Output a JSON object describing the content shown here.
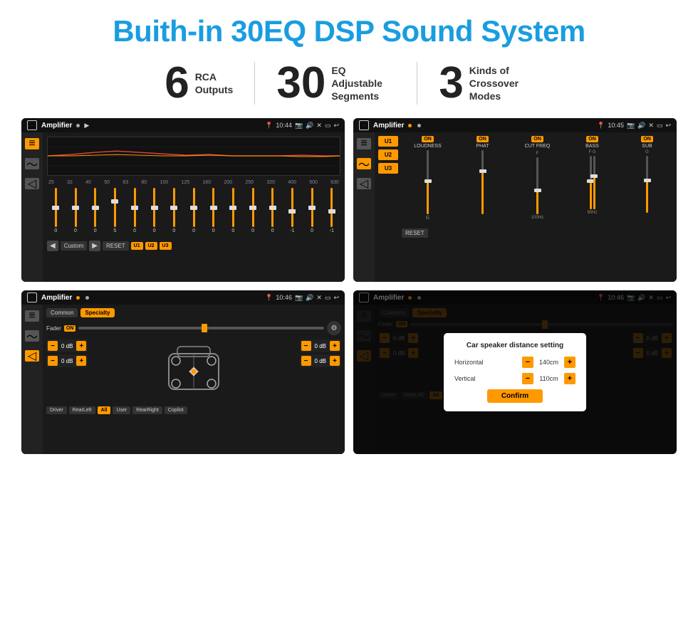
{
  "page": {
    "title": "Buith-in 30EQ DSP Sound System",
    "stats": [
      {
        "number": "6",
        "label": "RCA\nOutputs"
      },
      {
        "number": "30",
        "label": "EQ Adjustable\nSegments"
      },
      {
        "number": "3",
        "label": "Kinds of\nCrossover Modes"
      }
    ]
  },
  "screens": {
    "eq": {
      "title": "Amplifier",
      "time": "10:44",
      "freq_labels": [
        "25",
        "32",
        "40",
        "50",
        "63",
        "80",
        "100",
        "125",
        "160",
        "200",
        "250",
        "320",
        "400",
        "500",
        "630"
      ],
      "values": [
        "0",
        "0",
        "0",
        "5",
        "0",
        "0",
        "0",
        "0",
        "0",
        "0",
        "0",
        "0",
        "-1",
        "0",
        "-1"
      ],
      "buttons": [
        "Custom",
        "RESET",
        "U1",
        "U2",
        "U3"
      ]
    },
    "crossover": {
      "title": "Amplifier",
      "time": "10:45",
      "presets": [
        "U1",
        "U2",
        "U3"
      ],
      "channels": [
        {
          "label": "LOUDNESS",
          "on": true
        },
        {
          "label": "PHAT",
          "on": true
        },
        {
          "label": "CUT FREQ",
          "on": true
        },
        {
          "label": "BASS",
          "on": true
        },
        {
          "label": "SUB",
          "on": true
        }
      ],
      "reset_btn": "RESET"
    },
    "speaker": {
      "title": "Amplifier",
      "time": "10:46",
      "tabs": [
        "Common",
        "Specialty"
      ],
      "active_tab": "Specialty",
      "fader_label": "Fader",
      "fader_on": "ON",
      "vol_rows": [
        {
          "value": "0 dB"
        },
        {
          "value": "0 dB"
        },
        {
          "value": "0 dB"
        },
        {
          "value": "0 dB"
        }
      ],
      "bottom_btns": [
        "Driver",
        "RearLeft",
        "All",
        "User",
        "RearRight",
        "Copilot"
      ],
      "active_btn": "All"
    },
    "dialog": {
      "title": "Amplifier",
      "time": "10:46",
      "dialog_title": "Car speaker distance setting",
      "horizontal_label": "Horizontal",
      "horizontal_value": "140cm",
      "vertical_label": "Vertical",
      "vertical_value": "110cm",
      "confirm_label": "Confirm"
    }
  }
}
